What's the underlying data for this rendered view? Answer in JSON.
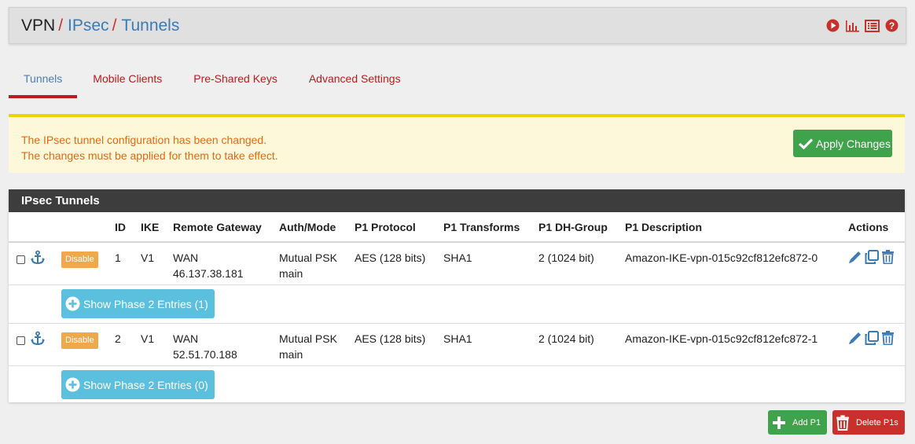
{
  "breadcrumb": {
    "items": [
      "VPN",
      "IPsec",
      "Tunnels"
    ],
    "separator": "/"
  },
  "header_icons": [
    "play-circle-icon",
    "bar-chart-icon",
    "list-icon",
    "help-icon"
  ],
  "tabs": [
    {
      "label": "Tunnels",
      "active": true
    },
    {
      "label": "Mobile Clients",
      "active": false
    },
    {
      "label": "Pre-Shared Keys",
      "active": false
    },
    {
      "label": "Advanced Settings",
      "active": false
    }
  ],
  "alert": {
    "line1": "The IPsec tunnel configuration has been changed.",
    "line2": "The changes must be applied for them to take effect.",
    "button_label": "Apply Changes"
  },
  "panel": {
    "title": "IPsec Tunnels",
    "columns": {
      "id": "ID",
      "ike": "IKE",
      "remote_gateway": "Remote Gateway",
      "auth_mode": "Auth/Mode",
      "p1_protocol": "P1 Protocol",
      "p1_transforms": "P1 Transforms",
      "p1_dh_group": "P1 DH-Group",
      "p1_description": "P1 Description",
      "actions": "Actions"
    },
    "tunnels": [
      {
        "disable_label": "Disable",
        "id": "1",
        "ike": "V1",
        "gateway_if": "WAN",
        "gateway_ip": "46.137.38.181",
        "auth": "Mutual PSK",
        "mode": "main",
        "protocol": "AES (128 bits)",
        "transforms": "SHA1",
        "dh_group": "2 (1024 bit)",
        "description": "Amazon-IKE-vpn-015c92cf812efc872-0",
        "phase2_label": "Show Phase 2 Entries (1)"
      },
      {
        "disable_label": "Disable",
        "id": "2",
        "ike": "V1",
        "gateway_if": "WAN",
        "gateway_ip": "52.51.70.188",
        "auth": "Mutual PSK",
        "mode": "main",
        "protocol": "AES (128 bits)",
        "transforms": "SHA1",
        "dh_group": "2 (1024 bit)",
        "description": "Amazon-IKE-vpn-015c92cf812efc872-1",
        "phase2_label": "Show Phase 2 Entries (0)"
      }
    ]
  },
  "footer": {
    "add_label": "Add P1",
    "delete_label": "Delete P1s"
  },
  "colors": {
    "accent_red": "#c9302c",
    "link_blue": "#3c7ab4",
    "success_green": "#3ea34a",
    "info_blue": "#5bc0de",
    "warning_orange": "#f0a94a"
  }
}
